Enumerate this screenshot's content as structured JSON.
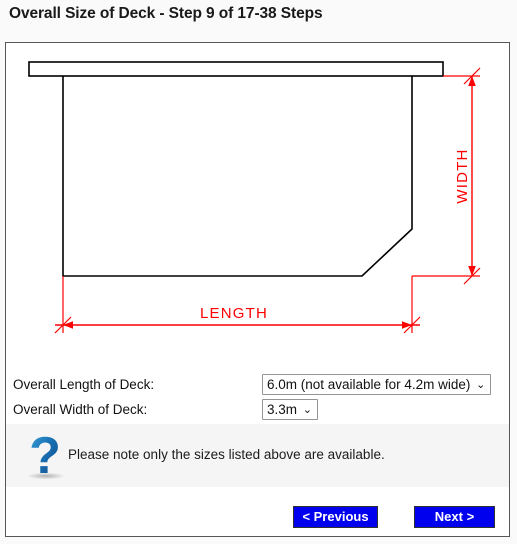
{
  "header": {
    "title": "Overall Size of Deck - Step 9 of 17-38 Steps"
  },
  "diagram": {
    "name": "deck-plan-drawing",
    "width_label": "WIDTH",
    "length_label": "LENGTH",
    "outline_color": "#000000",
    "dimension_color": "#ff0000"
  },
  "form": {
    "length": {
      "label": "Overall Length of Deck:",
      "value": "6.0m (not available for 4.2m wide)"
    },
    "width": {
      "label": "Overall Width of Deck:",
      "value": "3.3m"
    }
  },
  "note": {
    "icon": "question-mark-icon",
    "text": "Please note only the sizes listed above are available."
  },
  "nav": {
    "previous_label": "< Previous",
    "next_label": "Next >",
    "button_color": "#0000ee"
  }
}
